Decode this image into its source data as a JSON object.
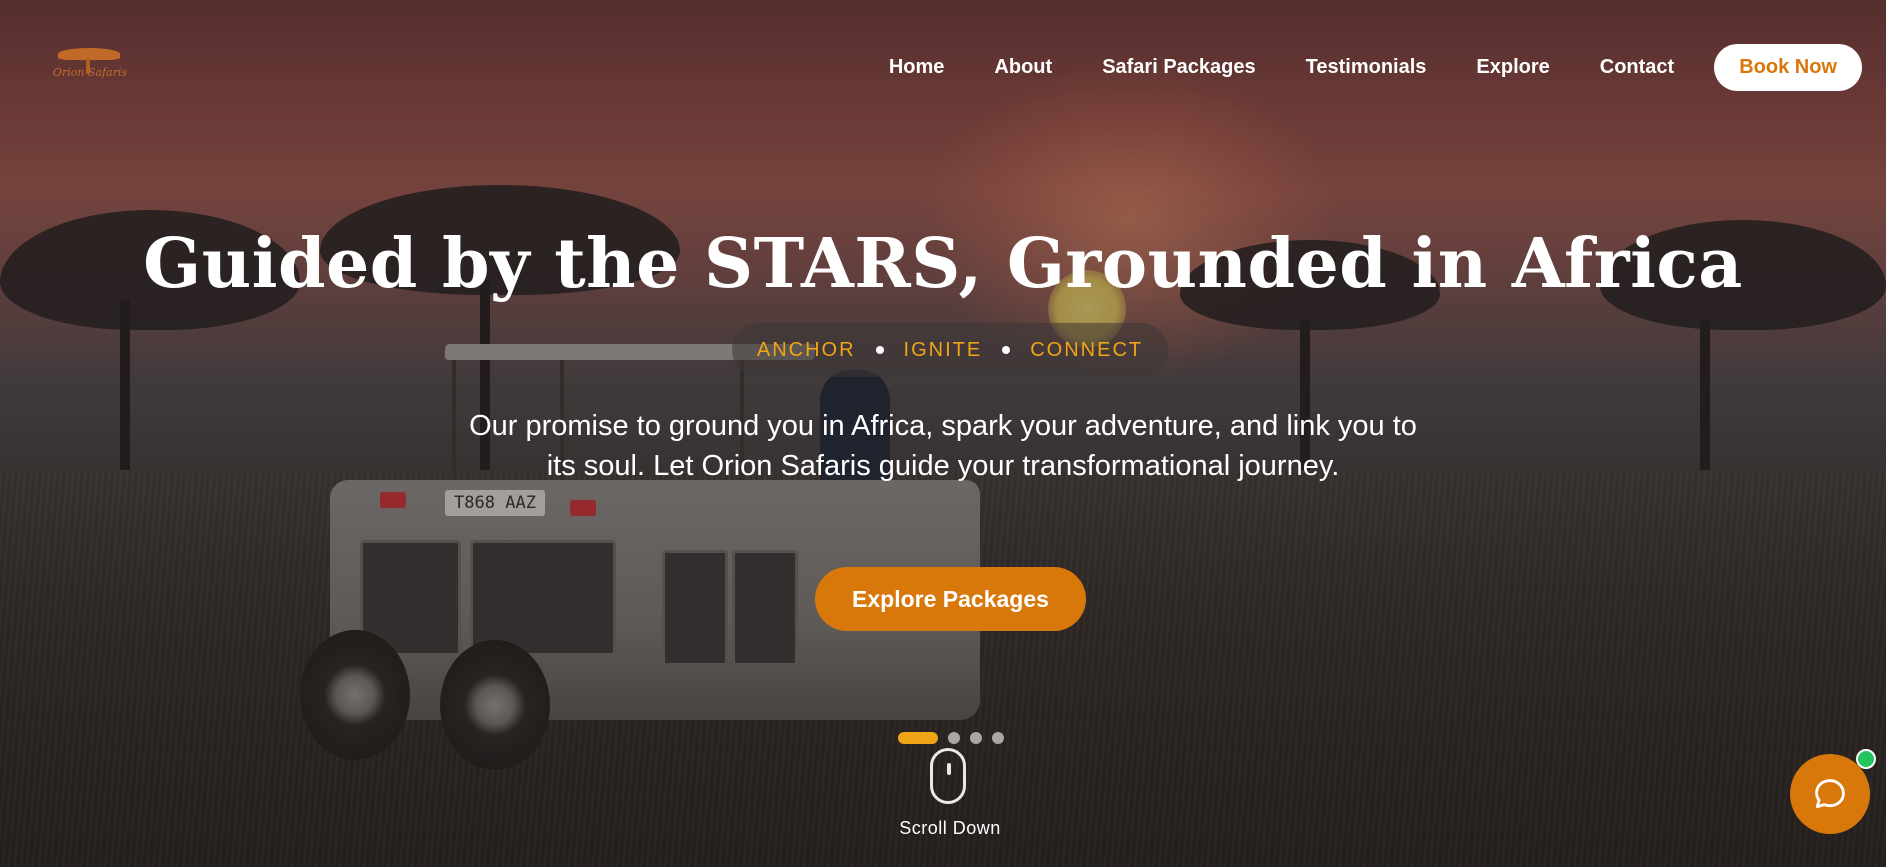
{
  "brand": {
    "logo_text": "Orion Safaris",
    "accent_color": "#d9780a",
    "highlight_color": "#f0a516"
  },
  "nav": {
    "items": [
      {
        "label": "Home"
      },
      {
        "label": "About"
      },
      {
        "label": "Safari Packages"
      },
      {
        "label": "Testimonials"
      },
      {
        "label": "Explore"
      },
      {
        "label": "Contact"
      }
    ],
    "book_label": "Book Now"
  },
  "hero": {
    "headline": "Guided by the STARS, Grounded in Africa",
    "pillars": [
      "ANCHOR",
      "IGNITE",
      "CONNECT"
    ],
    "tagline": "Our promise to ground you in Africa, spark your adventure, and link you to its soul. Let Orion Safaris guide your transformational journey.",
    "cta_label": "Explore Packages",
    "vehicle_plate": "T868 AAZ",
    "slides": {
      "count": 4,
      "active": 1
    }
  },
  "scroll": {
    "label": "Scroll Down",
    "icon": "mouse-icon"
  },
  "chat": {
    "icon": "chat-bubble-icon",
    "status_color": "#22c55e"
  }
}
